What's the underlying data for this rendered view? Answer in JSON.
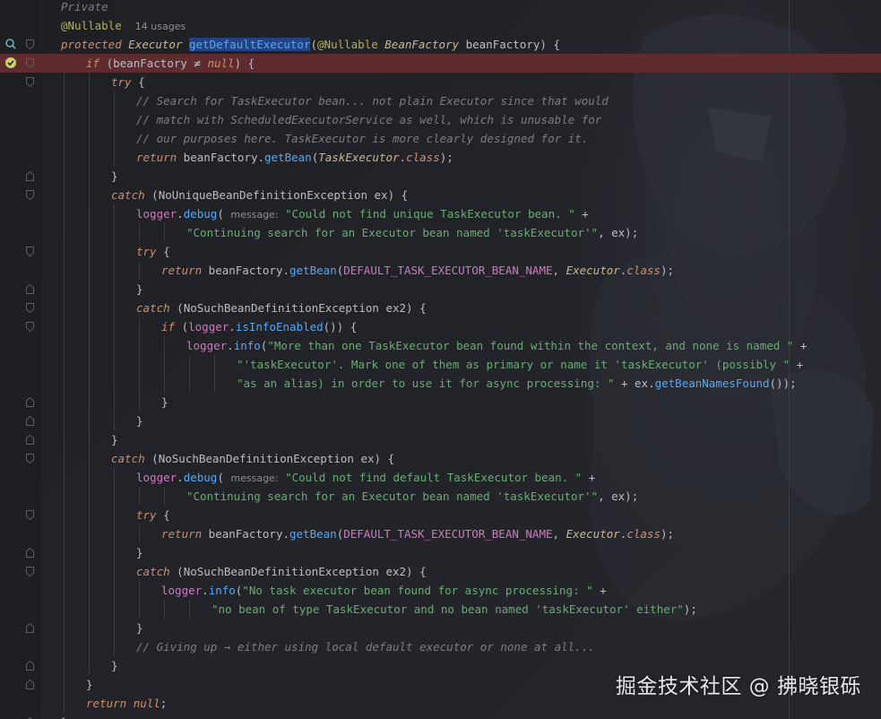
{
  "editor": {
    "usages": "14 usages",
    "watermark": "掘金技术社区 @ 拂晓银砾"
  },
  "lines": [
    {
      "indent": 1,
      "tokens": [
        {
          "c": "tok-cm",
          "t": "Private"
        }
      ]
    },
    {
      "indent": 1,
      "tokens": [
        {
          "c": "tok-ann",
          "t": "@Nullable"
        },
        {
          "c": "tok-plain",
          "t": "  "
        },
        {
          "c": "tok-usage",
          "t": "14 usages"
        }
      ]
    },
    {
      "indent": 1,
      "tokens": [
        {
          "c": "tok-kw",
          "t": "protected"
        },
        {
          "c": "tok-plain",
          "t": " "
        },
        {
          "c": "tok-type",
          "t": "Executor"
        },
        {
          "c": "tok-plain",
          "t": " "
        },
        {
          "c": "tok-fnsel",
          "t": "getDefaultExecutor"
        },
        {
          "c": "tok-plain",
          "t": "("
        },
        {
          "c": "tok-ann",
          "t": "@Nullable"
        },
        {
          "c": "tok-plain",
          "t": " "
        },
        {
          "c": "tok-type",
          "t": "BeanFactory"
        },
        {
          "c": "tok-plain",
          "t": " beanFactory) {"
        }
      ]
    },
    {
      "indent": 2,
      "breakpoint": true,
      "tokens": [
        {
          "c": "tok-kw",
          "t": "if"
        },
        {
          "c": "tok-plain",
          "t": " (beanFactory ≠ "
        },
        {
          "c": "tok-kw",
          "t": "null"
        },
        {
          "c": "tok-plain",
          "t": ") {"
        }
      ]
    },
    {
      "indent": 3,
      "tokens": [
        {
          "c": "tok-kw",
          "t": "try"
        },
        {
          "c": "tok-plain",
          "t": " {"
        }
      ]
    },
    {
      "indent": 4,
      "tokens": [
        {
          "c": "tok-cm",
          "t": "// Search for TaskExecutor bean... not plain Executor since that would"
        }
      ]
    },
    {
      "indent": 4,
      "tokens": [
        {
          "c": "tok-cm",
          "t": "// match with ScheduledExecutorService as well, which is unusable for"
        }
      ]
    },
    {
      "indent": 4,
      "tokens": [
        {
          "c": "tok-cm",
          "t": "// our purposes here. TaskExecutor is more clearly designed for it."
        }
      ]
    },
    {
      "indent": 4,
      "tokens": [
        {
          "c": "tok-kw",
          "t": "return"
        },
        {
          "c": "tok-plain",
          "t": " beanFactory."
        },
        {
          "c": "tok-fn",
          "t": "getBean"
        },
        {
          "c": "tok-plain",
          "t": "("
        },
        {
          "c": "tok-type",
          "t": "TaskExecutor"
        },
        {
          "c": "tok-plain",
          "t": "."
        },
        {
          "c": "tok-kw",
          "t": "class"
        },
        {
          "c": "tok-plain",
          "t": ");"
        }
      ]
    },
    {
      "indent": 3,
      "tokens": [
        {
          "c": "tok-plain",
          "t": "}"
        }
      ]
    },
    {
      "indent": 3,
      "tokens": [
        {
          "c": "tok-kw",
          "t": "catch"
        },
        {
          "c": "tok-plain",
          "t": " (NoUniqueBeanDefinitionException ex) {"
        }
      ]
    },
    {
      "indent": 4,
      "tokens": [
        {
          "c": "tok-field",
          "t": "logger"
        },
        {
          "c": "tok-plain",
          "t": "."
        },
        {
          "c": "tok-fn",
          "t": "debug"
        },
        {
          "c": "tok-plain",
          "t": "( "
        },
        {
          "c": "tok-hint",
          "t": "message:"
        },
        {
          "c": "tok-plain",
          "t": " "
        },
        {
          "c": "tok-str",
          "t": "\"Could not find unique TaskExecutor bean. \""
        },
        {
          "c": "tok-plain",
          "t": " +"
        }
      ]
    },
    {
      "indent": 6,
      "tokens": [
        {
          "c": "tok-str",
          "t": "\"Continuing search for an Executor bean named 'taskExecutor'\""
        },
        {
          "c": "tok-plain",
          "t": ", ex);"
        }
      ]
    },
    {
      "indent": 4,
      "tokens": [
        {
          "c": "tok-kw",
          "t": "try"
        },
        {
          "c": "tok-plain",
          "t": " {"
        }
      ]
    },
    {
      "indent": 5,
      "tokens": [
        {
          "c": "tok-kw",
          "t": "return"
        },
        {
          "c": "tok-plain",
          "t": " beanFactory."
        },
        {
          "c": "tok-fn",
          "t": "getBean"
        },
        {
          "c": "tok-plain",
          "t": "("
        },
        {
          "c": "tok-const",
          "t": "DEFAULT_TASK_EXECUTOR_BEAN_NAME"
        },
        {
          "c": "tok-plain",
          "t": ", "
        },
        {
          "c": "tok-type",
          "t": "Executor"
        },
        {
          "c": "tok-plain",
          "t": "."
        },
        {
          "c": "tok-kw",
          "t": "class"
        },
        {
          "c": "tok-plain",
          "t": ");"
        }
      ]
    },
    {
      "indent": 4,
      "tokens": [
        {
          "c": "tok-plain",
          "t": "}"
        }
      ]
    },
    {
      "indent": 4,
      "tokens": [
        {
          "c": "tok-kw",
          "t": "catch"
        },
        {
          "c": "tok-plain",
          "t": " (NoSuchBeanDefinitionException ex2) {"
        }
      ]
    },
    {
      "indent": 5,
      "tokens": [
        {
          "c": "tok-kw",
          "t": "if"
        },
        {
          "c": "tok-plain",
          "t": " ("
        },
        {
          "c": "tok-field",
          "t": "logger"
        },
        {
          "c": "tok-plain",
          "t": "."
        },
        {
          "c": "tok-fn",
          "t": "isInfoEnabled"
        },
        {
          "c": "tok-plain",
          "t": "()) {"
        }
      ]
    },
    {
      "indent": 6,
      "tokens": [
        {
          "c": "tok-field",
          "t": "logger"
        },
        {
          "c": "tok-plain",
          "t": "."
        },
        {
          "c": "tok-fn",
          "t": "info"
        },
        {
          "c": "tok-plain",
          "t": "("
        },
        {
          "c": "tok-str",
          "t": "\"More than one TaskExecutor bean found within the context, and none is named \""
        },
        {
          "c": "tok-plain",
          "t": " +"
        }
      ]
    },
    {
      "indent": 8,
      "tokens": [
        {
          "c": "tok-str",
          "t": "\"'taskExecutor'. Mark one of them as primary or name it 'taskExecutor' (possibly \""
        },
        {
          "c": "tok-plain",
          "t": " +"
        }
      ]
    },
    {
      "indent": 8,
      "tokens": [
        {
          "c": "tok-str",
          "t": "\"as an alias) in order to use it for async processing: \""
        },
        {
          "c": "tok-plain",
          "t": " + ex."
        },
        {
          "c": "tok-fn",
          "t": "getBeanNamesFound"
        },
        {
          "c": "tok-plain",
          "t": "());"
        }
      ]
    },
    {
      "indent": 5,
      "tokens": [
        {
          "c": "tok-plain",
          "t": "}"
        }
      ]
    },
    {
      "indent": 4,
      "tokens": [
        {
          "c": "tok-plain",
          "t": "}"
        }
      ]
    },
    {
      "indent": 3,
      "tokens": [
        {
          "c": "tok-plain",
          "t": "}"
        }
      ]
    },
    {
      "indent": 3,
      "tokens": [
        {
          "c": "tok-kw",
          "t": "catch"
        },
        {
          "c": "tok-plain",
          "t": " (NoSuchBeanDefinitionException ex) {"
        }
      ]
    },
    {
      "indent": 4,
      "tokens": [
        {
          "c": "tok-field",
          "t": "logger"
        },
        {
          "c": "tok-plain",
          "t": "."
        },
        {
          "c": "tok-fn",
          "t": "debug"
        },
        {
          "c": "tok-plain",
          "t": "( "
        },
        {
          "c": "tok-hint",
          "t": "message:"
        },
        {
          "c": "tok-plain",
          "t": " "
        },
        {
          "c": "tok-str",
          "t": "\"Could not find default TaskExecutor bean. \""
        },
        {
          "c": "tok-plain",
          "t": " +"
        }
      ]
    },
    {
      "indent": 6,
      "tokens": [
        {
          "c": "tok-str",
          "t": "\"Continuing search for an Executor bean named 'taskExecutor'\""
        },
        {
          "c": "tok-plain",
          "t": ", ex);"
        }
      ]
    },
    {
      "indent": 4,
      "tokens": [
        {
          "c": "tok-kw",
          "t": "try"
        },
        {
          "c": "tok-plain",
          "t": " {"
        }
      ]
    },
    {
      "indent": 5,
      "tokens": [
        {
          "c": "tok-kw",
          "t": "return"
        },
        {
          "c": "tok-plain",
          "t": " beanFactory."
        },
        {
          "c": "tok-fn",
          "t": "getBean"
        },
        {
          "c": "tok-plain",
          "t": "("
        },
        {
          "c": "tok-const",
          "t": "DEFAULT_TASK_EXECUTOR_BEAN_NAME"
        },
        {
          "c": "tok-plain",
          "t": ", "
        },
        {
          "c": "tok-type",
          "t": "Executor"
        },
        {
          "c": "tok-plain",
          "t": "."
        },
        {
          "c": "tok-kw",
          "t": "class"
        },
        {
          "c": "tok-plain",
          "t": ");"
        }
      ]
    },
    {
      "indent": 4,
      "tokens": [
        {
          "c": "tok-plain",
          "t": "}"
        }
      ]
    },
    {
      "indent": 4,
      "tokens": [
        {
          "c": "tok-kw",
          "t": "catch"
        },
        {
          "c": "tok-plain",
          "t": " (NoSuchBeanDefinitionException ex2) {"
        }
      ]
    },
    {
      "indent": 5,
      "tokens": [
        {
          "c": "tok-field",
          "t": "logger"
        },
        {
          "c": "tok-plain",
          "t": "."
        },
        {
          "c": "tok-fn",
          "t": "info"
        },
        {
          "c": "tok-plain",
          "t": "("
        },
        {
          "c": "tok-str",
          "t": "\"No task executor bean found for async processing: \""
        },
        {
          "c": "tok-plain",
          "t": " +"
        }
      ]
    },
    {
      "indent": 7,
      "tokens": [
        {
          "c": "tok-str",
          "t": "\"no bean of type TaskExecutor and no bean named 'taskExecutor' either\""
        },
        {
          "c": "tok-plain",
          "t": ");"
        }
      ]
    },
    {
      "indent": 4,
      "tokens": [
        {
          "c": "tok-plain",
          "t": "}"
        }
      ]
    },
    {
      "indent": 4,
      "tokens": [
        {
          "c": "tok-cm",
          "t": "// Giving up → either using local default executor or none at all..."
        }
      ]
    },
    {
      "indent": 3,
      "tokens": [
        {
          "c": "tok-plain",
          "t": "}"
        }
      ]
    },
    {
      "indent": 2,
      "tokens": [
        {
          "c": "tok-plain",
          "t": "}"
        }
      ]
    },
    {
      "indent": 2,
      "tokens": [
        {
          "c": "tok-kw",
          "t": "return"
        },
        {
          "c": "tok-plain",
          "t": " "
        },
        {
          "c": "tok-kw",
          "t": "null"
        },
        {
          "c": "tok-plain",
          "t": ";"
        }
      ]
    },
    {
      "indent": 1,
      "tokens": [
        {
          "c": "tok-plain",
          "t": "}"
        }
      ]
    }
  ]
}
